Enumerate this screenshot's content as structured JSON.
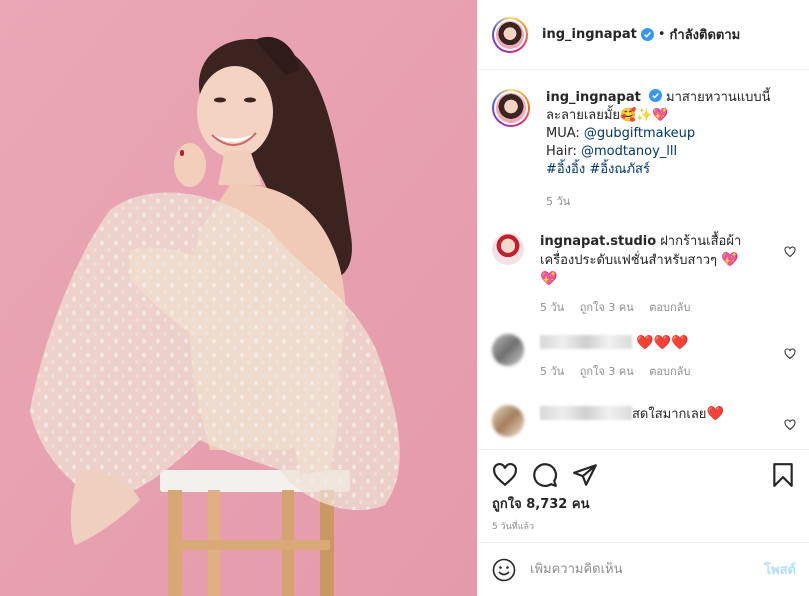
{
  "header": {
    "username": "ing_ingnapat",
    "separator": "•",
    "follow_label": "กำลังติดตาม"
  },
  "caption": {
    "username": "ing_ingnapat",
    "text_line1": "มาสายหวานแบบนี้",
    "text_line2": "ละลายเลยมั้ย",
    "emojis": "🥰✨💖",
    "mua_prefix": "MUA: ",
    "mua_handle": "@gubgiftmakeup",
    "hair_prefix": "Hair: ",
    "hair_handle": "@modtanoy_lll",
    "hashtags": "#อิ้งอิ้ง #อิ้งณภัสร์",
    "time": "5 วัน"
  },
  "comments": [
    {
      "username": "ingnapat.studio",
      "text": "ฝากร้านเสื้อผ้า เครื่องประดับแฟชั่นสำหรับสาวๆ",
      "emoji": "💖",
      "emoji2": "💖",
      "time": "5 วัน",
      "likes": "ถูกใจ 3 คน",
      "reply": "ตอบกลับ"
    },
    {
      "username": "",
      "text": "",
      "emoji": "❤️❤️❤️",
      "time": "5 วัน",
      "likes": "ถูกใจ 3 คน",
      "reply": "ตอบกลับ"
    },
    {
      "username": "",
      "text": "สดใสมากเลย",
      "emoji": "❤️"
    }
  ],
  "actions": {
    "icons": [
      "heart-icon",
      "comment-icon",
      "share-icon",
      "bookmark-icon"
    ]
  },
  "likes_text": "ถูกใจ 8,732 คน",
  "time_ago": "5 วันที่แล้ว",
  "add_comment": {
    "placeholder": "เพิ่มความคิดเห็น",
    "post_label": "โพสต์"
  },
  "colors": {
    "photo_background": "#e9a4b3",
    "link": "#00376b",
    "verified": "#3897f0",
    "post_button_disabled": "#b2dffc"
  }
}
